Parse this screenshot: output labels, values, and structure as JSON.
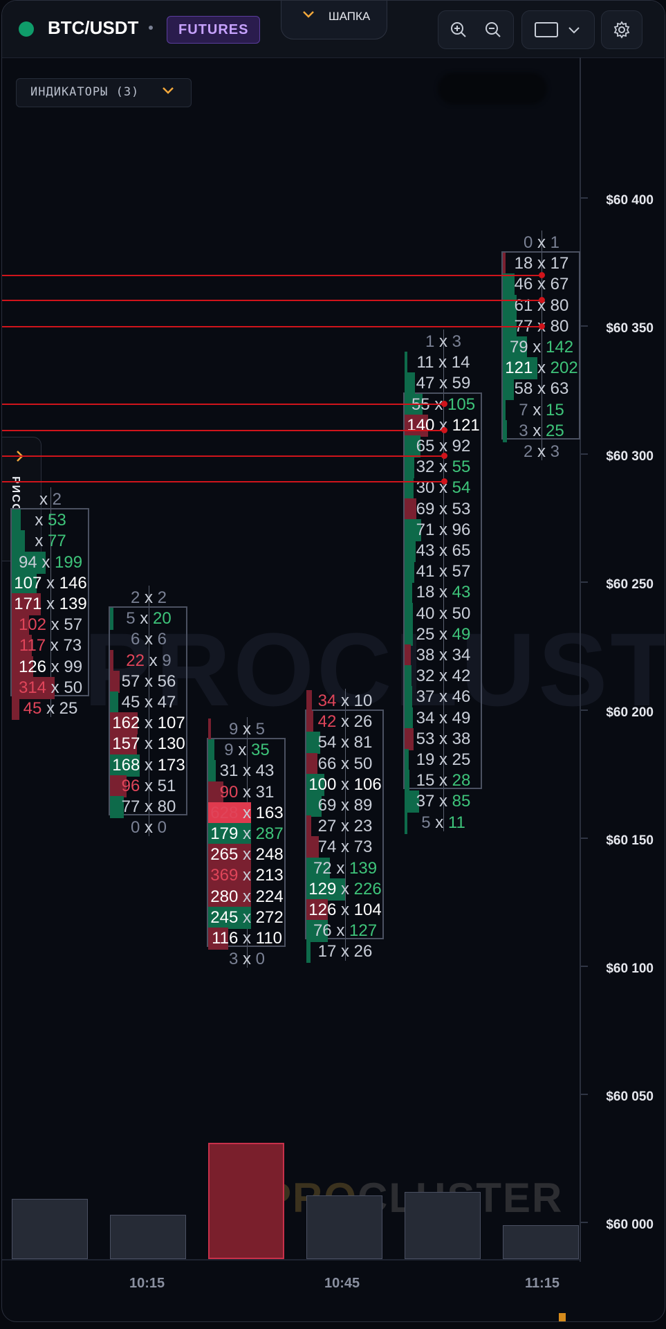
{
  "header": {
    "symbol": "BTC/USDT",
    "market_badge": "FUTURES",
    "header_tab_label": "ШАПКА",
    "status_color": "#0f9c6a",
    "accent_color": "#f2a73b",
    "badge_color": "#c7a2ff"
  },
  "toolbar": {
    "zoom_in_icon": "zoom-in-icon",
    "zoom_out_icon": "zoom-out-icon",
    "view_icon": "rectangle-icon",
    "settings_icon": "gear-icon"
  },
  "indicators": {
    "label": "ИНДИКАТОРЫ (3)"
  },
  "drawing_panel": {
    "label": "РИСОВАНИЕ"
  },
  "price_axis": [
    "$60 400",
    "$60 350",
    "$60 300",
    "$60 250",
    "$60 200",
    "$60 150",
    "$60 100",
    "$60 050",
    "$60 000"
  ],
  "time_axis": [
    "10:15",
    "10:45",
    "11:15"
  ],
  "watermark": {
    "main": "PROCLUSTER",
    "pro": "PRO",
    "cluster": "CLUSTER"
  },
  "chart_data": {
    "type": "footprint",
    "price_axis_labels": [
      "$60 400",
      "$60 350",
      "$60 300",
      "$60 250",
      "$60 200",
      "$60 150",
      "$60 100",
      "$60 050",
      "$60 000"
    ],
    "time_labels": [
      "10:15",
      "10:45",
      "11:15"
    ],
    "candles": [
      {
        "rows": [
          [
            "",
            "2"
          ],
          [
            "",
            "53"
          ],
          [
            "",
            "77"
          ],
          [
            "94",
            "199"
          ],
          [
            "107",
            "146"
          ],
          [
            "171",
            "139"
          ],
          [
            "102",
            "57"
          ],
          [
            "117",
            "73"
          ],
          [
            "126",
            "99"
          ],
          [
            "314",
            "50"
          ],
          [
            "45",
            "25"
          ]
        ]
      },
      {
        "rows": [
          [
            "2",
            "2"
          ],
          [
            "5",
            "20"
          ],
          [
            "6",
            "6"
          ],
          [
            "22",
            "9"
          ],
          [
            "57",
            "56"
          ],
          [
            "45",
            "47"
          ],
          [
            "162",
            "107"
          ],
          [
            "157",
            "130"
          ],
          [
            "168",
            "173"
          ],
          [
            "96",
            "51"
          ],
          [
            "77",
            "80"
          ],
          [
            "0",
            "0"
          ]
        ]
      },
      {
        "rows": [
          [
            "9",
            "5"
          ],
          [
            "9",
            "35"
          ],
          [
            "31",
            "43"
          ],
          [
            "90",
            "31"
          ],
          [
            "628",
            "163"
          ],
          [
            "179",
            "287"
          ],
          [
            "265",
            "248"
          ],
          [
            "369",
            "213"
          ],
          [
            "280",
            "224"
          ],
          [
            "245",
            "272"
          ],
          [
            "116",
            "110"
          ],
          [
            "3",
            "0"
          ]
        ]
      },
      {
        "rows": [
          [
            "34",
            "10"
          ],
          [
            "42",
            "26"
          ],
          [
            "54",
            "81"
          ],
          [
            "66",
            "50"
          ],
          [
            "100",
            "106"
          ],
          [
            "69",
            "89"
          ],
          [
            "27",
            "23"
          ],
          [
            "74",
            "73"
          ],
          [
            "72",
            "139"
          ],
          [
            "129",
            "226"
          ],
          [
            "126",
            "104"
          ],
          [
            "76",
            "127"
          ],
          [
            "17",
            "26"
          ]
        ]
      },
      {
        "rows": [
          [
            "1",
            "3"
          ],
          [
            "11",
            "14"
          ],
          [
            "47",
            "59"
          ],
          [
            "55",
            "105"
          ],
          [
            "140",
            "121"
          ],
          [
            "65",
            "92"
          ],
          [
            "32",
            "55"
          ],
          [
            "30",
            "54"
          ],
          [
            "69",
            "53"
          ],
          [
            "71",
            "96"
          ],
          [
            "43",
            "65"
          ],
          [
            "41",
            "57"
          ],
          [
            "18",
            "43"
          ],
          [
            "40",
            "50"
          ],
          [
            "25",
            "49"
          ],
          [
            "38",
            "34"
          ],
          [
            "32",
            "42"
          ],
          [
            "37",
            "46"
          ],
          [
            "34",
            "49"
          ],
          [
            "53",
            "38"
          ],
          [
            "19",
            "25"
          ],
          [
            "15",
            "28"
          ],
          [
            "37",
            "85"
          ],
          [
            "5",
            "11"
          ]
        ]
      },
      {
        "rows": [
          [
            "0",
            "1"
          ],
          [
            "18",
            "17"
          ],
          [
            "46",
            "67"
          ],
          [
            "61",
            "80"
          ],
          [
            "77",
            "80"
          ],
          [
            "79",
            "142"
          ],
          [
            "121",
            "202"
          ],
          [
            "58",
            "63"
          ],
          [
            "7",
            "15"
          ],
          [
            "3",
            "25"
          ],
          [
            "2",
            "3"
          ]
        ]
      }
    ],
    "volume_bars": [
      {
        "value": 0.52,
        "highlight": false
      },
      {
        "value": 0.38,
        "highlight": false
      },
      {
        "value": 1.0,
        "highlight": true
      },
      {
        "value": 0.55,
        "highlight": false
      },
      {
        "value": 0.58,
        "highlight": false
      },
      {
        "value": 0.29,
        "highlight": false
      }
    ]
  }
}
